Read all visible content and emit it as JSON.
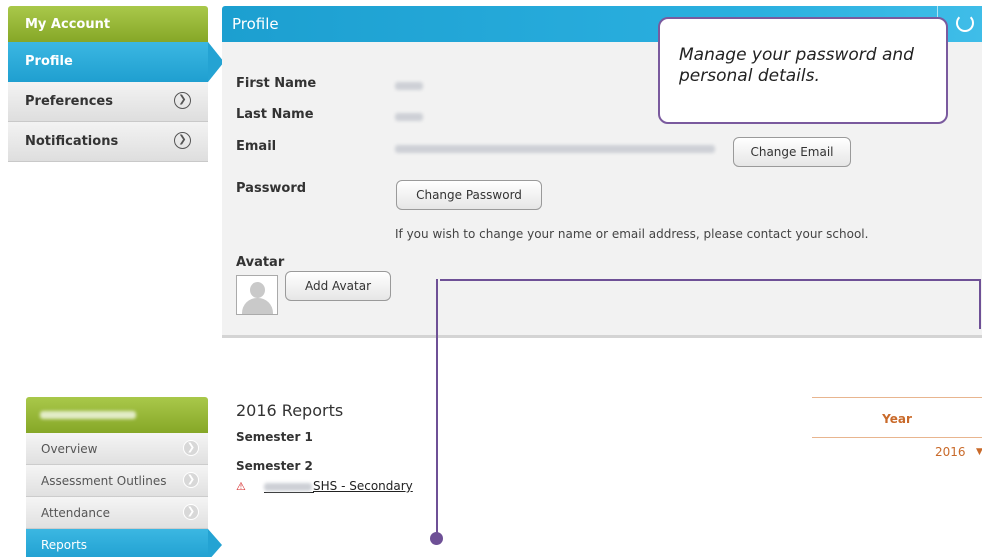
{
  "account_menu": {
    "title": "My Account",
    "items": [
      {
        "label": "Profile",
        "active": true
      },
      {
        "label": "Preferences"
      },
      {
        "label": "Notifications"
      }
    ]
  },
  "profile": {
    "header": "Profile",
    "fields": {
      "first_name_label": "First Name",
      "last_name_label": "Last Name",
      "email_label": "Email",
      "password_label": "Password",
      "avatar_label": "Avatar"
    },
    "buttons": {
      "change_email": "Change Email",
      "change_password": "Change Password",
      "add_avatar": "Add Avatar"
    },
    "note": "If you wish to change your name or email address, please contact your school."
  },
  "callout": {
    "text": "Manage your password and personal details."
  },
  "student_menu": {
    "items": [
      {
        "label": "Overview"
      },
      {
        "label": "Assessment Outlines"
      },
      {
        "label": "Attendance"
      },
      {
        "label": "Reports",
        "active": true
      }
    ]
  },
  "reports": {
    "title": "2016 Reports",
    "semesters": [
      "Semester 1",
      "Semester 2"
    ],
    "link_suffix": "SHS - Secondary",
    "year_header": "Year",
    "year_value": "2016"
  },
  "colors": {
    "accent_blue": "#1f9fd0",
    "accent_green": "#86a727",
    "callout_purple": "#6e5096",
    "year_orange": "#c96a2a"
  }
}
